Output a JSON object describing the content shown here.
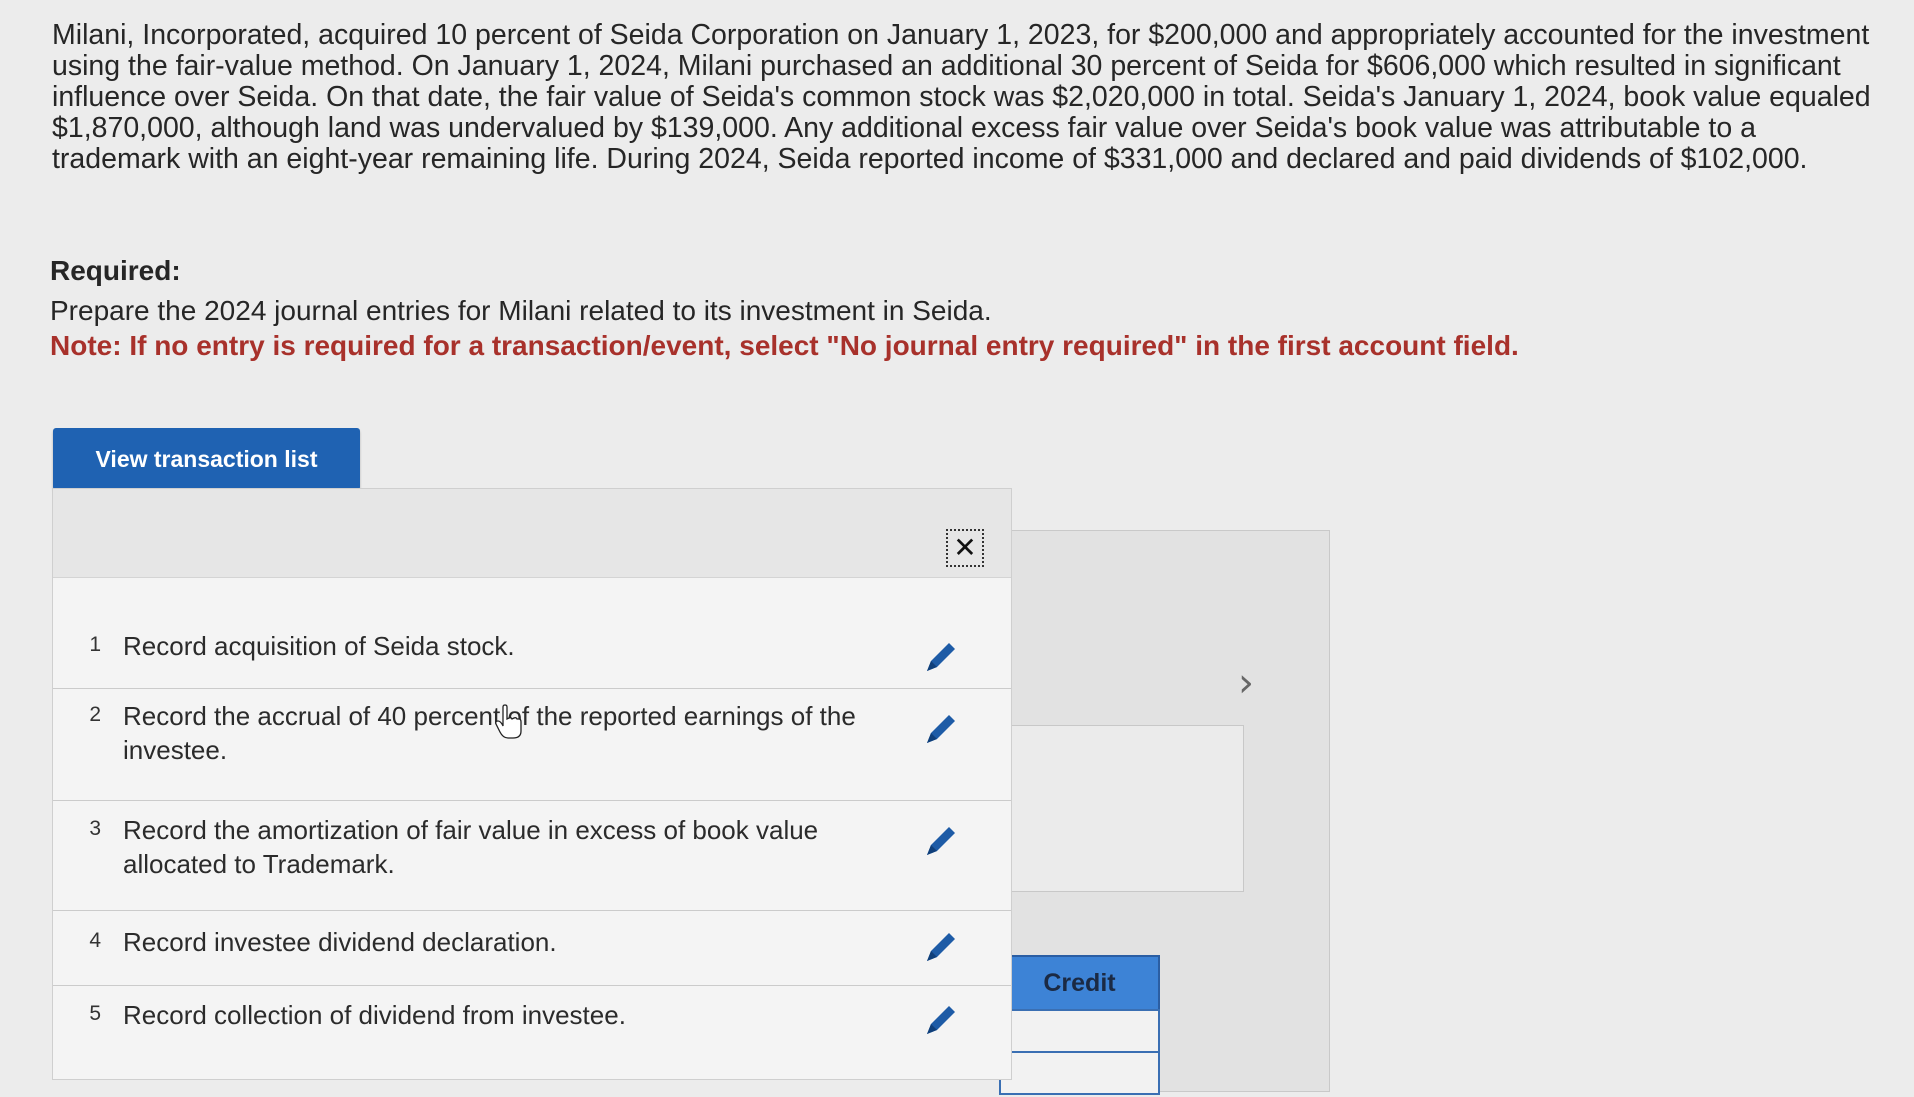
{
  "problem": {
    "text": "Milani, Incorporated, acquired 10 percent of Seida Corporation on January 1, 2023, for $200,000 and appropriately accounted for the investment using the fair-value method. On January 1, 2024, Milani purchased an additional 30 percent of Seida for $606,000 which resulted in significant influence over Seida. On that date, the fair value of Seida's common stock was $2,020,000 in total. Seida's January 1, 2024, book value equaled $1,870,000, although land was undervalued by $139,000. Any additional excess fair value over Seida's book value was attributable to a trademark with an eight-year remaining life. During 2024, Seida reported income of $331,000 and declared and paid dividends of $102,000."
  },
  "required": {
    "heading": "Required:",
    "text": "Prepare the 2024 journal entries for Milani related to its investment in Seida.",
    "note": "Note: If no entry is required for a transaction/event, select \"No journal entry required\" in the first account field."
  },
  "view_transaction_button": "View transaction list",
  "transaction_list": {
    "rows": [
      {
        "num": "1",
        "desc": "Record acquisition of Seida stock."
      },
      {
        "num": "2",
        "desc": "Record the accrual of 40 percent of the reported earnings of the investee."
      },
      {
        "num": "3",
        "desc": "Record the amortization of fair value in excess of book value allocated to Trademark."
      },
      {
        "num": "4",
        "desc": "Record investee dividend declaration."
      },
      {
        "num": "5",
        "desc": "Record collection of dividend from investee."
      }
    ]
  },
  "journal": {
    "credit_header": "Credit"
  },
  "icons": {
    "close": "close-icon",
    "edit": "pencil-icon",
    "next": "chevron-right-icon"
  },
  "colors": {
    "accent": "#1f62b2",
    "note": "#a8312b",
    "credit_header": "#3d83d6"
  }
}
